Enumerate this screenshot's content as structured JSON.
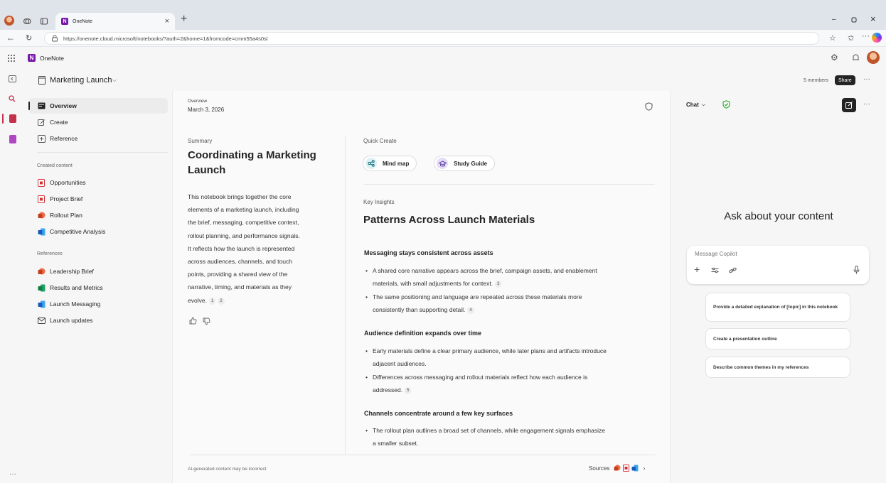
{
  "browser": {
    "tab_title": "OneNote",
    "url": "https://onenote.cloud.microsoft/notebooks/?auth=2&home=1&fromcode=cmm55a4s0sl"
  },
  "app": {
    "name": "OneNote"
  },
  "notebook": {
    "title": "Marketing Launch",
    "members": "5 members",
    "share_label": "Share"
  },
  "nav": {
    "top": [
      "Overview",
      "Create",
      "Reference"
    ],
    "created_title": "Created content",
    "created": [
      "Opportunities",
      "Project Brief",
      "Rollout Plan",
      "Competitive Analysis"
    ],
    "refs_title": "References",
    "refs": [
      "Leadership Brief",
      "Results and Metrics",
      "Launch Messaging",
      "Launch updates"
    ]
  },
  "overview": {
    "label": "Overview",
    "date": "March 3, 2026",
    "summary_label": "Summary",
    "summary_title": "Coordinating a Marketing Launch",
    "summary_lines": [
      "This notebook brings together the core",
      "elements of a marketing launch, including",
      "the brief, messaging, competitive context,",
      "rollout planning, and performance signals.",
      "It reflects how the launch is represented",
      "across audiences, channels, and touch",
      "points, providing a shared view of the",
      "narrative, timing, and materials as they",
      "evolve."
    ],
    "summary_cites": [
      "1",
      "2"
    ],
    "quick_create_label": "Quick Create",
    "mindmap": "Mind map",
    "study_guide": "Study Guide",
    "insights_label": "Key Insights",
    "insights_title": "Patterns Across Launch Materials",
    "sections": [
      {
        "heading": "Messaging stays consistent across assets",
        "bullets": [
          {
            "lines": [
              "A shared core narrative appears across the brief, campaign assets, and enablement",
              "materials, with small adjustments for context."
            ],
            "cite": "3"
          },
          {
            "lines": [
              "The same positioning and language are repeated across these materials more",
              "consistently than supporting detail."
            ],
            "cite": "4"
          }
        ]
      },
      {
        "heading": "Audience definition expands over time",
        "bullets": [
          {
            "lines": [
              "Early materials define a clear primary audience, while later plans and artifacts introduce",
              "adjacent audiences."
            ],
            "cite": ""
          },
          {
            "lines": [
              "Differences across messaging and rollout materials reflect how each audience is",
              "addressed."
            ],
            "cite": "5"
          }
        ]
      },
      {
        "heading": "Channels concentrate around a few key surfaces",
        "bullets": [
          {
            "lines": [
              "The rollout plan outlines a broad set of channels, while engagement signals emphasize",
              "a smaller subset."
            ],
            "cite": ""
          }
        ]
      }
    ],
    "disclaimer": "AI-generated content may be incorrect",
    "sources_label": "Sources"
  },
  "chat": {
    "label": "Chat",
    "ask_title": "Ask about your content",
    "placeholder": "Message Copilot",
    "suggestions": [
      "Provide a detailed explanation of [topic] in this notebook",
      "Create a presentation outline",
      "Describe common themes in my references"
    ]
  },
  "colors": {
    "accent_purple": "#7719aa",
    "pink": "#c4314b",
    "ref_red": "#d13438",
    "ref_blue": "#185abd",
    "green": "#13a10e"
  }
}
